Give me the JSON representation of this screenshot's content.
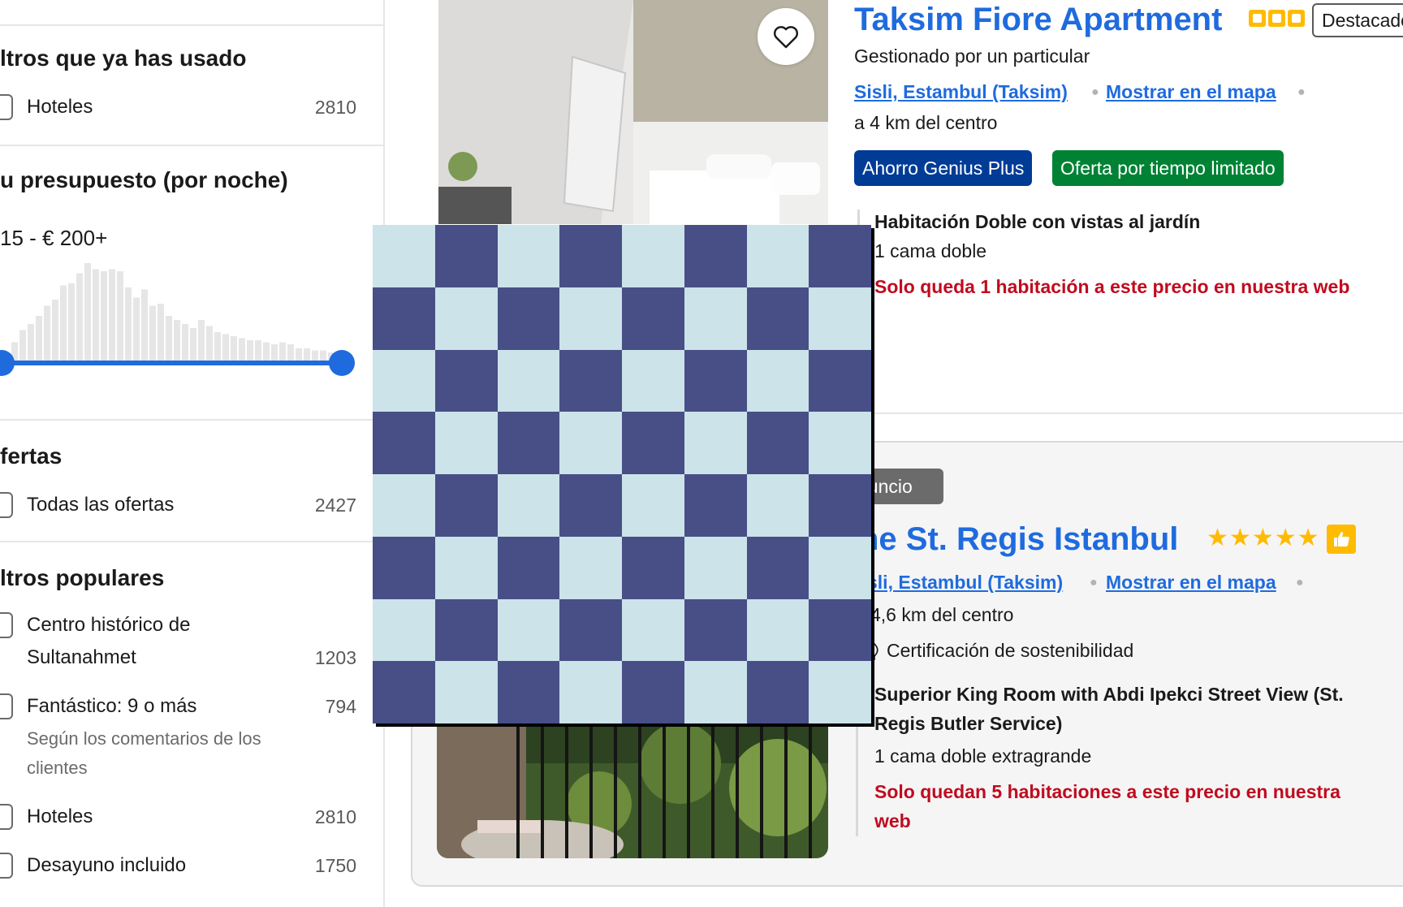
{
  "sidebar": {
    "used_filters": {
      "heading": "ltros que ya has usado",
      "items": [
        {
          "label": "Hoteles",
          "count": "2810"
        }
      ]
    },
    "budget": {
      "heading": "u presupuesto (por noche)",
      "range": "15 - € 200+",
      "histogram": [
        8,
        18,
        30,
        36,
        44,
        54,
        60,
        74,
        76,
        86,
        96,
        90,
        88,
        90,
        88,
        72,
        62,
        70,
        54,
        56,
        44,
        40,
        36,
        32,
        40,
        34,
        28,
        26,
        24,
        22,
        20,
        20,
        18,
        16,
        18,
        16,
        12,
        12,
        10,
        10,
        8,
        8
      ]
    },
    "offers": {
      "heading": "fertas",
      "items": [
        {
          "label": "Todas las ofertas",
          "count": "2427"
        }
      ]
    },
    "popular": {
      "heading": "ltros populares",
      "items": [
        {
          "label_line1": "Centro histórico de",
          "label_line2": "Sultanahmet",
          "count": "1203"
        },
        {
          "label": "Fantástico: 9 o más",
          "count": "794",
          "sub": "Según los comentarios de los clientes"
        },
        {
          "label": "Hoteles",
          "count": "2810"
        },
        {
          "label": "Desayuno incluido",
          "count": "1750"
        }
      ]
    }
  },
  "listings": [
    {
      "title": "Taksim Fiore Apartment",
      "badge": "Destacado",
      "host": "Gestionado por un particular",
      "location_link": "Sisli, Estambul (Taksim)",
      "map_link": "Mostrar en el mapa",
      "distance": "a 4 km del centro",
      "pills": [
        "Ahorro Genius Plus",
        "Oferta por tiempo limitado"
      ],
      "room": "Habitación Doble con vistas al jardín",
      "bed": "1 cama doble",
      "availability": "Solo queda 1 habitación a este precio en nuestra web"
    },
    {
      "ad_label": "nuncio",
      "title": "he St. Regis Istanbul",
      "location_link": "sli, Estambul (Taksim)",
      "map_link": "Mostrar en el mapa",
      "distance": "4,6 km del centro",
      "sustainability": "Certificación de sostenibilidad",
      "room_line1": "Superior King Room with Abdi Ipekci Street View (St.",
      "room_line2": "Regis Butler Service)",
      "bed": "1 cama doble extragrande",
      "availability_line1": "Solo quedan 5 habitaciones a este precio en nuestra",
      "availability_line2": "web"
    }
  ],
  "colors": {
    "link_blue": "#1f6bde",
    "genius_blue": "#003b95",
    "offer_green": "#008234",
    "warning_red": "#c00b1f",
    "star_yellow": "#febb02",
    "checker_light": "#cce3ea",
    "checker_dark": "#474f86"
  },
  "icons": [
    "heart-icon",
    "star-icon",
    "thumbs-up-icon",
    "leaf-icon"
  ]
}
